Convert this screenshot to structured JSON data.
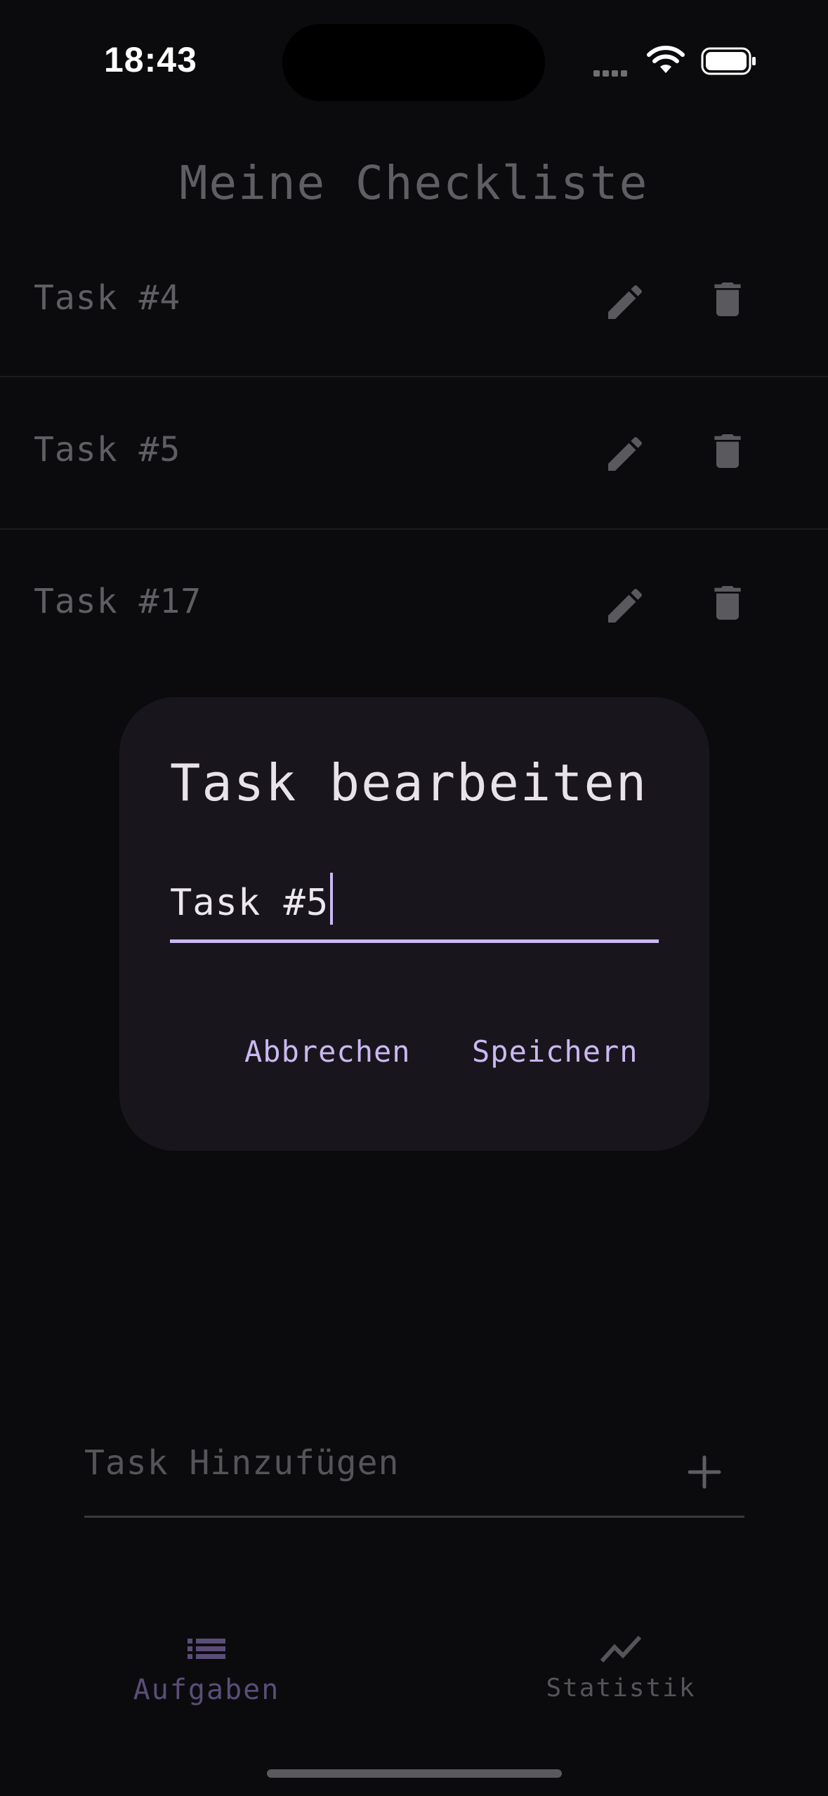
{
  "status_bar": {
    "time": "18:43"
  },
  "page": {
    "title": "Meine Checkliste"
  },
  "tasks": [
    {
      "label": "Task #4"
    },
    {
      "label": "Task #5"
    },
    {
      "label": "Task #17"
    }
  ],
  "dialog": {
    "title": "Task bearbeiten",
    "input_value": "Task #5",
    "cancel_label": "Abbrechen",
    "save_label": "Speichern"
  },
  "add_task": {
    "placeholder": "Task Hinzufügen"
  },
  "nav": {
    "items": [
      {
        "label": "Aufgaben",
        "icon": "list-icon",
        "active": true
      },
      {
        "label": "Statistik",
        "icon": "trending-icon",
        "active": false
      }
    ]
  },
  "colors": {
    "background": "#0b0b0d",
    "dialog": "#18161c",
    "accent": "#cbb8f2",
    "muted_text": "#5f5e62"
  }
}
